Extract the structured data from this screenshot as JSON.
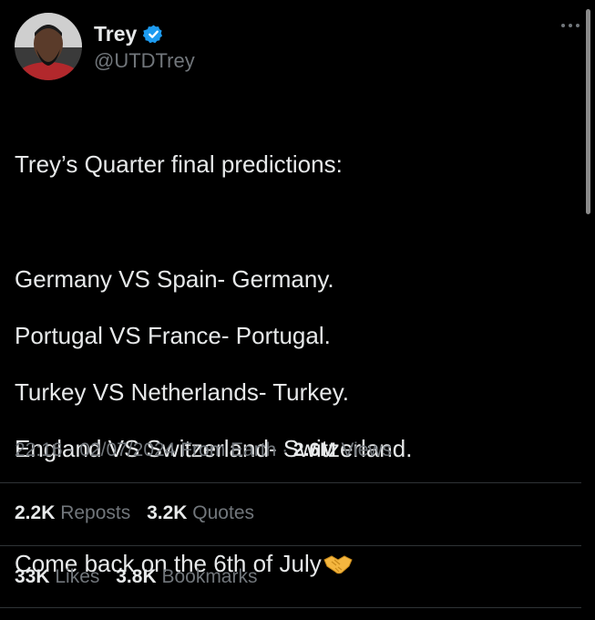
{
  "author": {
    "name": "Trey",
    "handle": "@UTDTrey",
    "verified": true
  },
  "tweet": {
    "heading": "Trey’s Quarter final predictions:",
    "predictions": [
      "Germany VS Spain- Germany.",
      "Portugal VS France- Portugal.",
      "Turkey VS Netherlands- Turkey.",
      "England VS Switzerland- Switzerland."
    ],
    "closing": "Come back on the 6th of July",
    "closing_emoji": "handshake"
  },
  "meta": {
    "time": "22:16",
    "date": "02/07/2024",
    "source": "From Earth",
    "views_count": "2.6M",
    "views_label": "Views",
    "separator": "·"
  },
  "stats": {
    "reposts_count": "2.2K",
    "reposts_label": "Reposts",
    "quotes_count": "3.2K",
    "quotes_label": "Quotes",
    "likes_count": "33K",
    "likes_label": "Likes",
    "bookmarks_count": "3.8K",
    "bookmarks_label": "Bookmarks"
  },
  "colors": {
    "background": "#000000",
    "text_primary": "#e7e9ea",
    "text_secondary": "#71767b",
    "verified_badge": "#1d9bf0",
    "divider": "#2f3336"
  }
}
